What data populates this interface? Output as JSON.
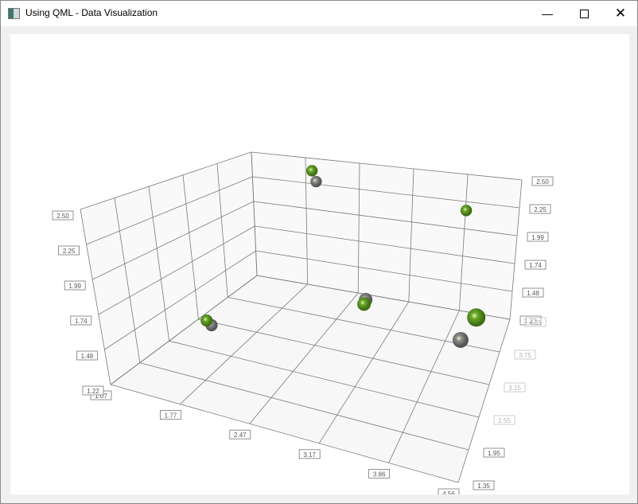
{
  "window": {
    "title": "Using QML - Data Visualization",
    "minimize_icon": "minimize-icon",
    "maximize_icon": "maximize-icon",
    "close_icon": "close-icon"
  },
  "chart_data": {
    "type": "scatter",
    "projection": "3d",
    "x_ticks": [
      "1.07",
      "1.77",
      "2.47",
      "3.17",
      "3.86",
      "4.56"
    ],
    "y_ticks": [
      "1.22",
      "1.48",
      "1.74",
      "1.99",
      "2.25",
      "2.50"
    ],
    "z_ticks": [
      "1.35",
      "1.95",
      "2.55",
      "3.15",
      "3.75",
      "4.35"
    ],
    "xlim": [
      1.07,
      4.56
    ],
    "ylim": [
      1.22,
      2.5
    ],
    "zlim": [
      1.35,
      4.35
    ],
    "grid": true,
    "series": [
      {
        "color": "#6aa82a",
        "points": [
          [
            1.5,
            1.45,
            2.6
          ],
          [
            2.0,
            2.45,
            4.1
          ],
          [
            3.0,
            1.6,
            3.3
          ],
          [
            3.9,
            2.2,
            4.25
          ],
          [
            4.45,
            1.95,
            2.6
          ]
        ]
      },
      {
        "color": "#8c8c8c",
        "points": [
          [
            1.55,
            1.42,
            2.6
          ],
          [
            2.05,
            2.35,
            4.1
          ],
          [
            3.0,
            1.62,
            3.35
          ],
          [
            4.2,
            1.55,
            3.1
          ]
        ]
      }
    ]
  }
}
